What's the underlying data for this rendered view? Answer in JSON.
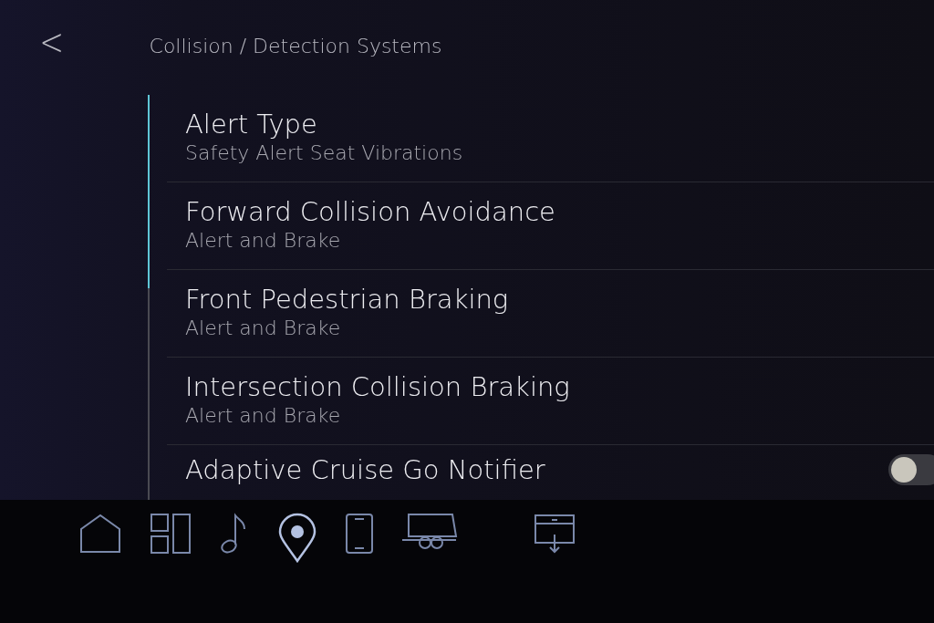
{
  "header": {
    "back": "<",
    "title": "Collision / Detection Systems"
  },
  "settings": [
    {
      "kind": "option",
      "title": "Alert Type",
      "value": "Safety Alert Seat Vibrations"
    },
    {
      "kind": "option",
      "title": "Forward Collision Avoidance",
      "value": "Alert and Brake"
    },
    {
      "kind": "option",
      "title": "Front Pedestrian Braking",
      "value": "Alert and Brake"
    },
    {
      "kind": "option",
      "title": "Intersection Collision Braking",
      "value": "Alert and Brake"
    },
    {
      "kind": "toggle",
      "title": "Adaptive Cruise Go Notifier",
      "on": false
    }
  ],
  "dock": [
    {
      "kind": "home",
      "selected": false
    },
    {
      "kind": "apps",
      "selected": false
    },
    {
      "kind": "music",
      "selected": false
    },
    {
      "kind": "pin",
      "selected": true
    },
    {
      "kind": "phone",
      "selected": false
    },
    {
      "kind": "trailer",
      "selected": false
    },
    {
      "kind": "tray",
      "selected": false
    }
  ]
}
